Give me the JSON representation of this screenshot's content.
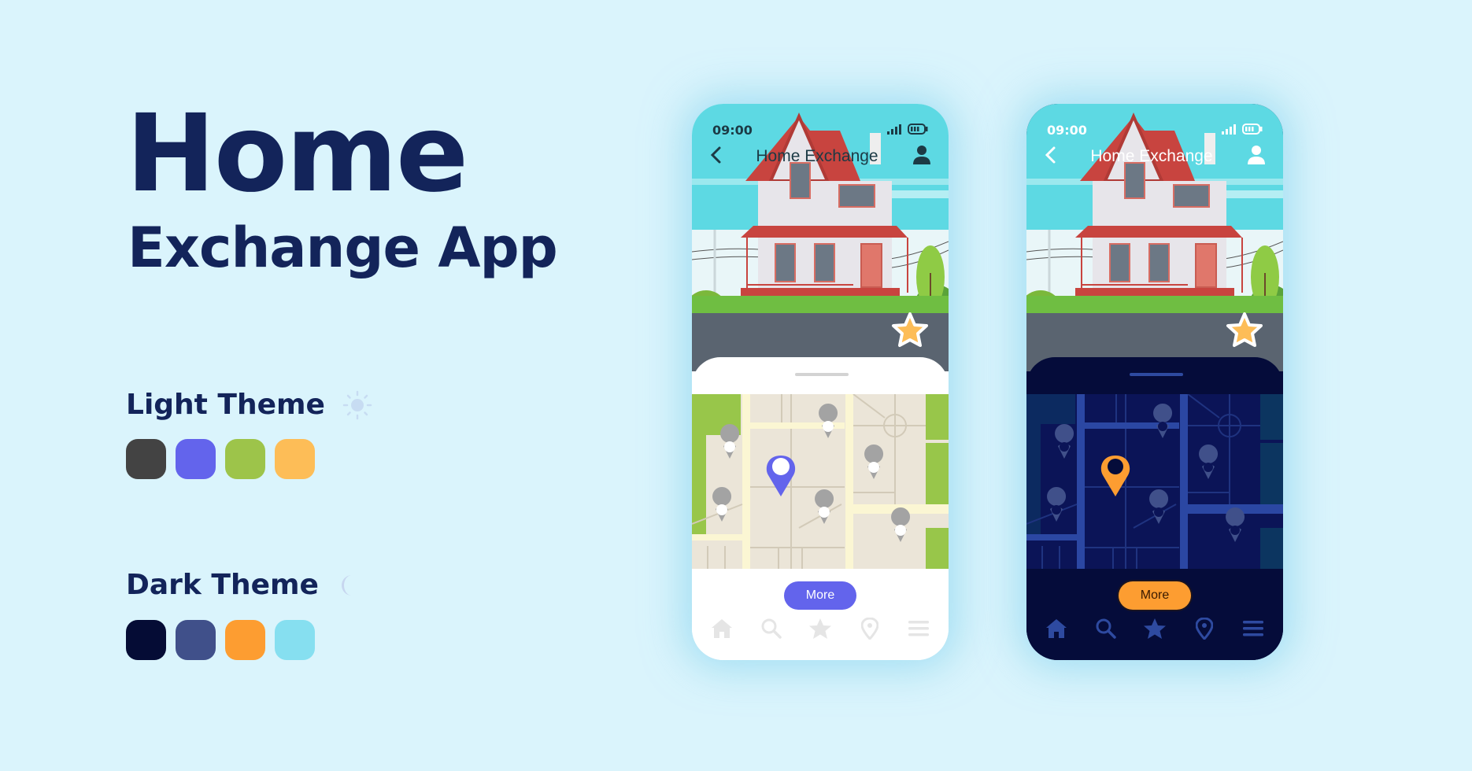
{
  "heading": {
    "title_line1": "Home",
    "title_line2": "Exchange App"
  },
  "themes": {
    "light": {
      "label": "Light Theme",
      "icon": "sun-icon",
      "swatches": [
        "#434343",
        "#6364ec",
        "#9dc44a",
        "#fdbd57"
      ]
    },
    "dark": {
      "label": "Dark Theme",
      "icon": "moon-icon",
      "swatches": [
        "#050c35",
        "#40508a",
        "#fd9d31",
        "#86dff0"
      ]
    }
  },
  "phones": {
    "light": {
      "status_time": "09:00",
      "title": "Home Exchange",
      "more_label": "More",
      "tabs": [
        "home-icon",
        "search-icon",
        "star-icon",
        "location-pin-icon",
        "menu-icon"
      ],
      "colors": {
        "header_text": "#1c3a45",
        "accent": "#6364ec",
        "tab_icon": "#e5e5e5"
      }
    },
    "dark": {
      "status_time": "09:00",
      "title": "Home Exchange",
      "more_label": "More",
      "tabs": [
        "home-icon",
        "search-icon",
        "star-icon",
        "location-pin-icon",
        "menu-icon"
      ],
      "colors": {
        "header_text": "#ffffff",
        "accent": "#fd9d31",
        "tab_icon": "#2e4aa0"
      }
    }
  }
}
